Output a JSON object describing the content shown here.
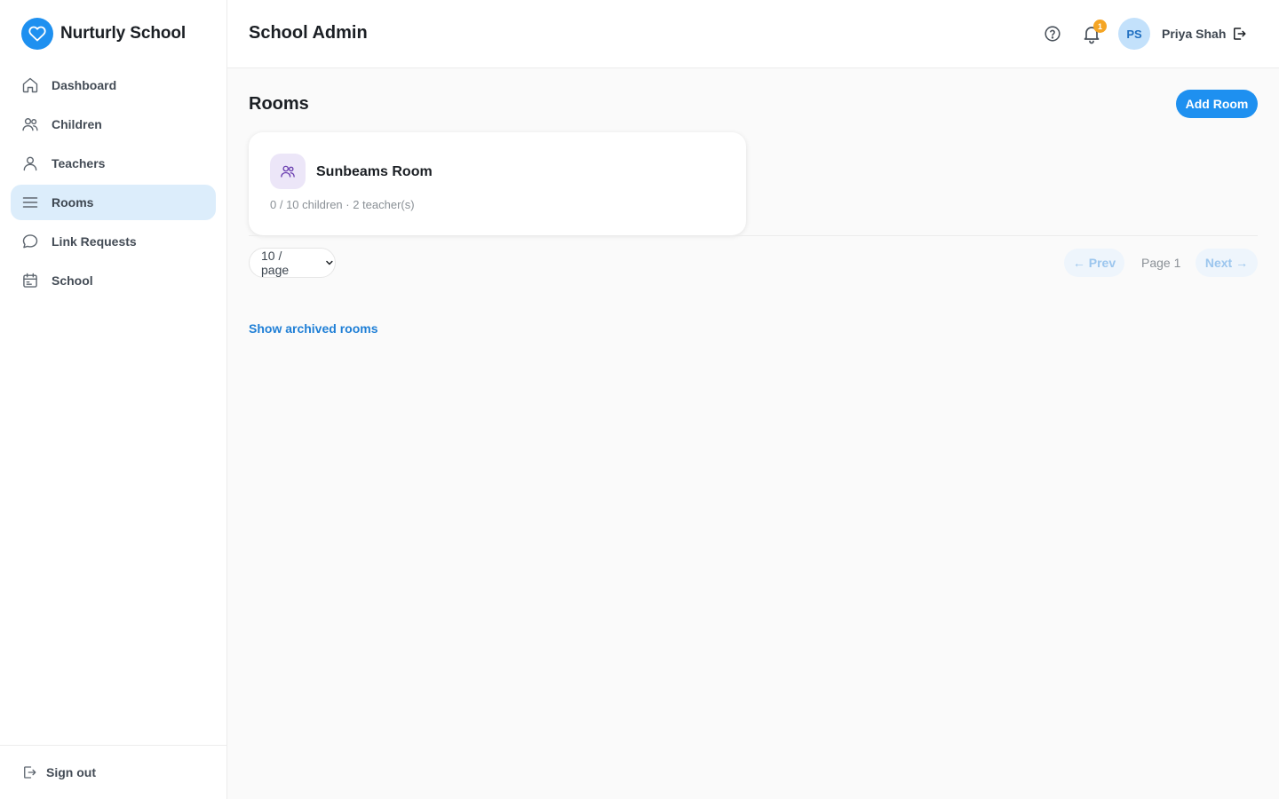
{
  "brand": {
    "name": "Nurturly School",
    "icon": "heart-icon",
    "color": "#1e90f0"
  },
  "sidebar": {
    "items": [
      {
        "label": "Dashboard",
        "icon": "home-icon",
        "active": false
      },
      {
        "label": "Children",
        "icon": "users-icon",
        "active": false
      },
      {
        "label": "Teachers",
        "icon": "user-icon",
        "active": false
      },
      {
        "label": "Rooms",
        "icon": "menu-icon",
        "active": true
      },
      {
        "label": "Link Requests",
        "icon": "chat-icon",
        "active": false
      },
      {
        "label": "School",
        "icon": "calendar-icon",
        "active": false
      }
    ],
    "sign_out": "Sign out"
  },
  "header": {
    "title": "School Admin",
    "notification_count": "1",
    "user": {
      "initials": "PS",
      "name": "Priya Shah"
    }
  },
  "main": {
    "title": "Rooms",
    "add_button": "Add Room",
    "rooms": [
      {
        "name": "Sunbeams Room",
        "meta": "0 / 10 children · 2 teacher(s)"
      }
    ],
    "pagination": {
      "page_size": "10 / page",
      "prev": "← Prev",
      "page": "Page 1",
      "next": "Next →"
    },
    "archived_link": "Show archived rooms"
  },
  "colors": {
    "accent": "#1e90f0",
    "active_nav_bg": "#dcedfb",
    "badge": "#f5a524",
    "avatar_bg": "#c3e1fb",
    "room_icon_bg": "#ece6f8"
  }
}
